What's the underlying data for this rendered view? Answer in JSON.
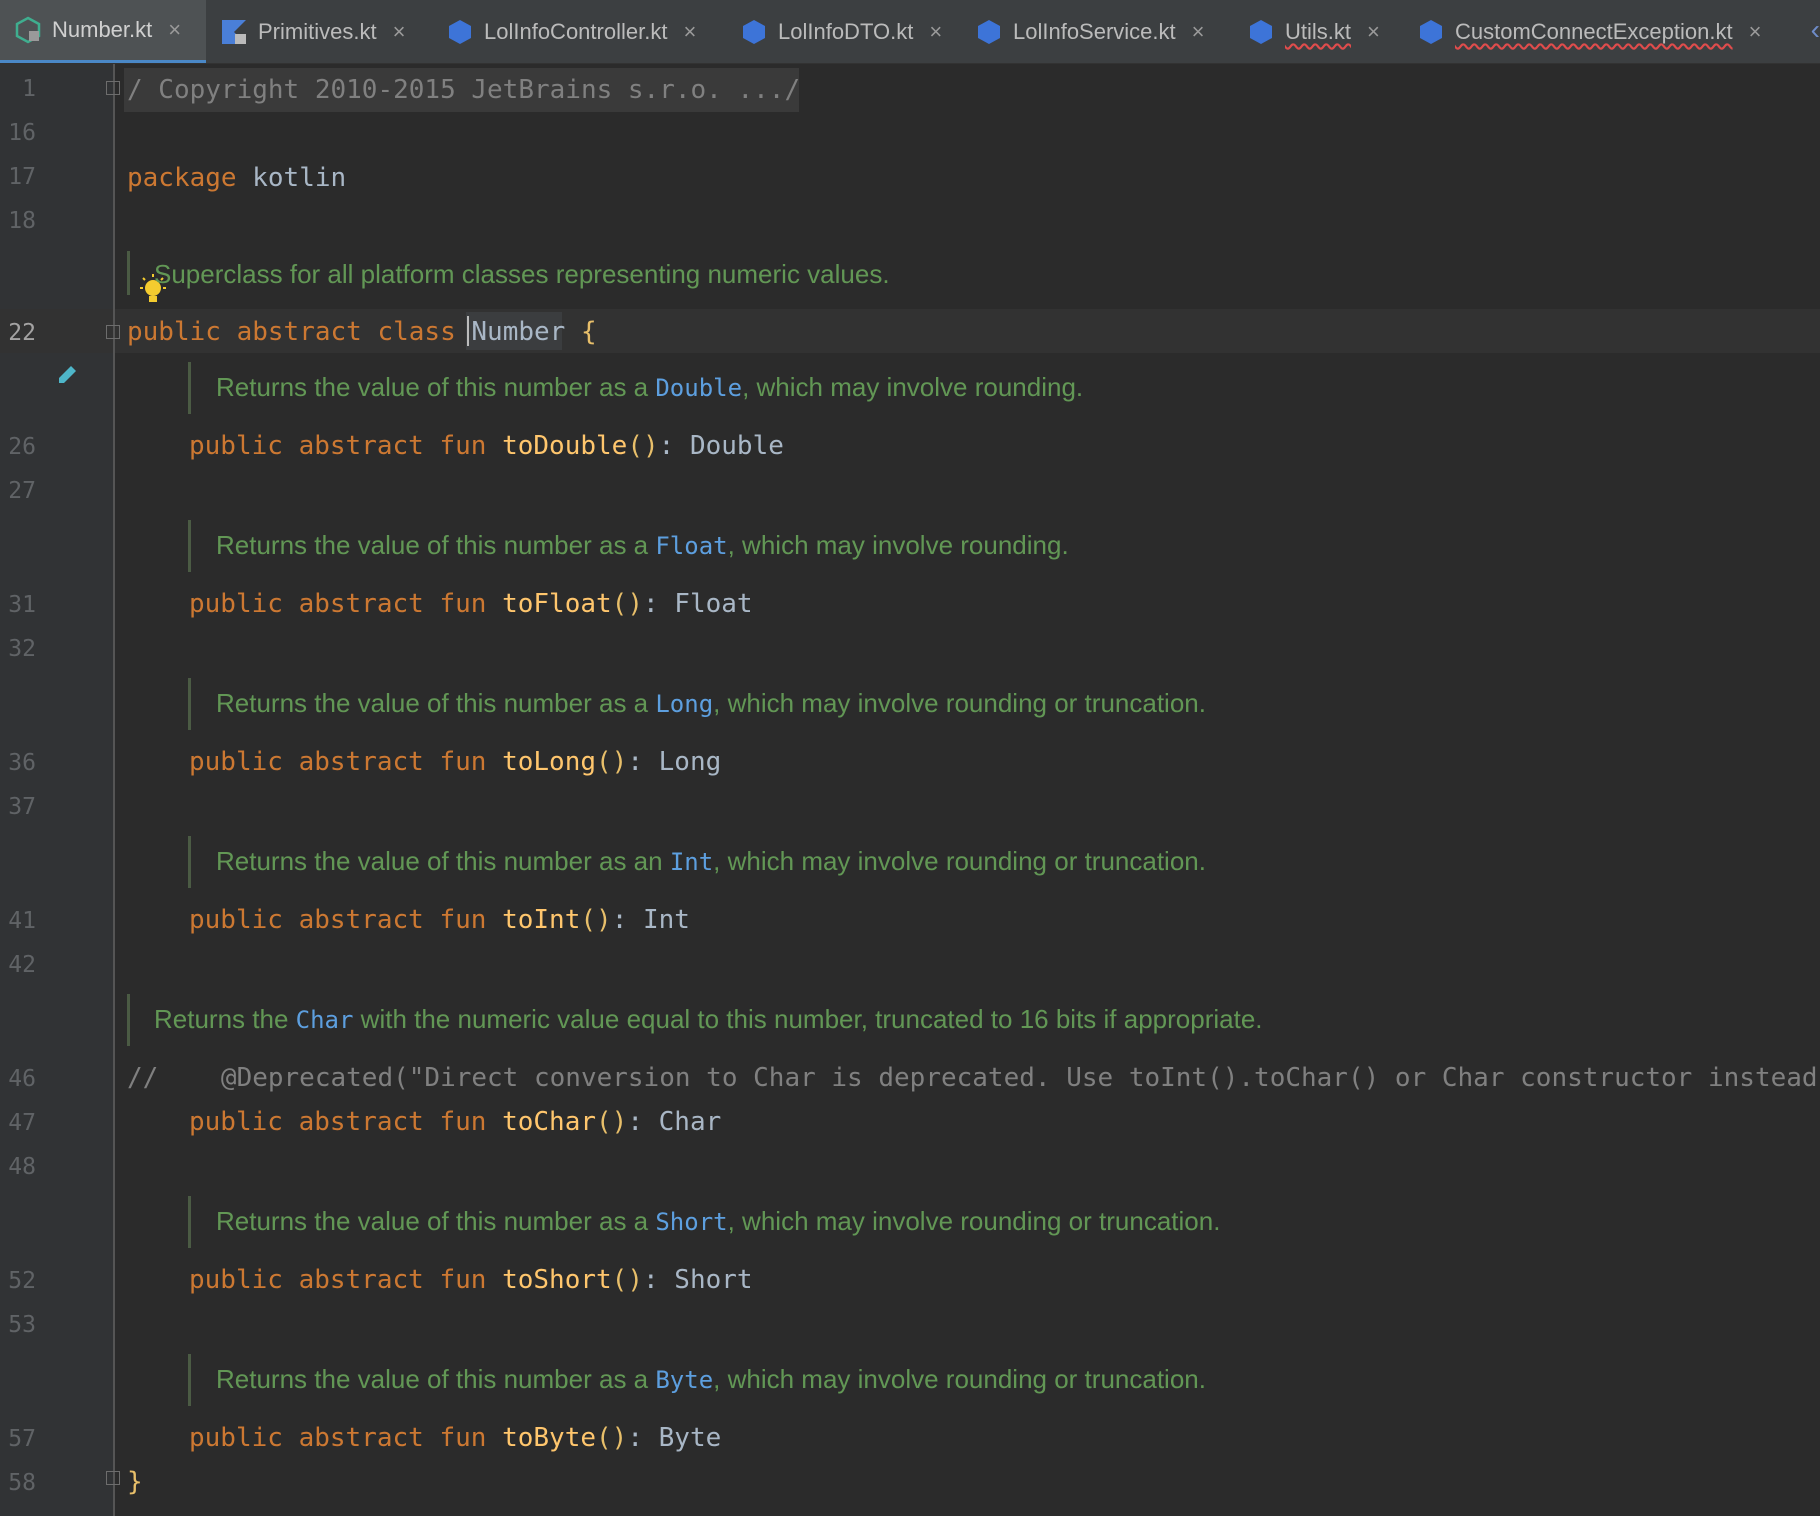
{
  "tabs": [
    {
      "label": "Number.kt",
      "active": true,
      "icon": "kotlin-file-icon",
      "error": false
    },
    {
      "label": "Primitives.kt",
      "active": false,
      "icon": "kotlin-file-locked-icon",
      "error": false
    },
    {
      "label": "LolInfoController.kt",
      "active": false,
      "icon": "kotlin-class-icon",
      "error": false
    },
    {
      "label": "LolInfoDTO.kt",
      "active": false,
      "icon": "kotlin-class-icon",
      "error": false
    },
    {
      "label": "LolInfoService.kt",
      "active": false,
      "icon": "kotlin-class-icon",
      "error": false
    },
    {
      "label": "Utils.kt",
      "active": false,
      "icon": "kotlin-class-icon",
      "error": true
    },
    {
      "label": "CustomConnectException.kt",
      "active": false,
      "icon": "kotlin-class-icon",
      "error": true
    }
  ],
  "tab_close_glyph": "×",
  "line_numbers": [
    "1",
    "16",
    "17",
    "18",
    "22",
    "26",
    "27",
    "31",
    "32",
    "36",
    "37",
    "41",
    "42",
    "46",
    "47",
    "48",
    "52",
    "53",
    "57",
    "58"
  ],
  "current_line": "22",
  "code": {
    "copyright": "/ Copyright 2010-2015 JetBrains s.r.o. .../",
    "package_kw": "package",
    "package_name": "kotlin",
    "class_doc": "Superclass for all platform classes representing numeric values.",
    "class_public": "public",
    "class_abstract": "abstract",
    "class_kw": "class",
    "class_name": "Number",
    "open_brace": "{",
    "close_brace": "}",
    "members": [
      {
        "doc_pre": "Returns the value of this number as a ",
        "doc_ref": "Double",
        "doc_post": ", which may involve rounding.",
        "fn": "toDouble",
        "ret": "Double"
      },
      {
        "doc_pre": "Returns the value of this number as a ",
        "doc_ref": "Float",
        "doc_post": ", which may involve rounding.",
        "fn": "toFloat",
        "ret": "Float"
      },
      {
        "doc_pre": "Returns the value of this number as a ",
        "doc_ref": "Long",
        "doc_post": ", which may involve rounding or truncation.",
        "fn": "toLong",
        "ret": "Long"
      },
      {
        "doc_pre": "Returns the value of this number as an ",
        "doc_ref": "Int",
        "doc_post": ", which may involve rounding or truncation.",
        "fn": "toInt",
        "ret": "Int"
      },
      {
        "doc_pre": "Returns the ",
        "doc_ref": "Char",
        "doc_post": " with the numeric value equal to this number, truncated to 16 bits if appropriate.",
        "fn": "toChar",
        "ret": "Char"
      },
      {
        "doc_pre": "Returns the value of this number as a ",
        "doc_ref": "Short",
        "doc_post": ", which may involve rounding or truncation.",
        "fn": "toShort",
        "ret": "Short"
      },
      {
        "doc_pre": "Returns the value of this number as a ",
        "doc_ref": "Byte",
        "doc_post": ", which may involve rounding or truncation.",
        "fn": "toByte",
        "ret": "Byte"
      }
    ],
    "deprecated_comment": "//    @Deprecated(\"Direct conversion to Char is deprecated. Use toInt().toChar() or Char constructor instead.",
    "fn_public": "public",
    "fn_abstract": "abstract",
    "fn_kw": "fun",
    "fn_parens": "()",
    "fn_colon": ": "
  }
}
